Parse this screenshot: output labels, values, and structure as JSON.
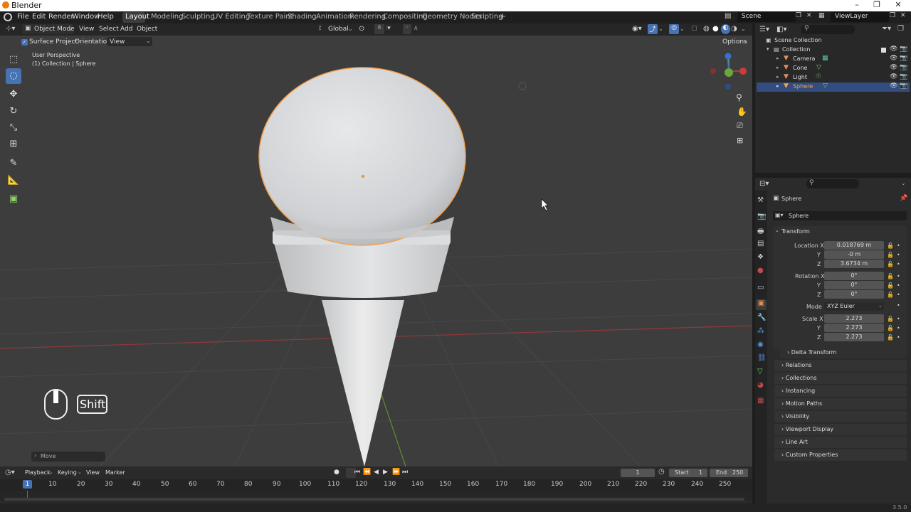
{
  "window": {
    "title": "Blender",
    "version": "3.5.0"
  },
  "menu": [
    "File",
    "Edit",
    "Render",
    "Window",
    "Help"
  ],
  "workspaces": [
    "Layout",
    "Modeling",
    "Sculpting",
    "UV Editing",
    "Texture Paint",
    "Shading",
    "Animation",
    "Rendering",
    "Compositing",
    "Geometry Nodes",
    "Scripting"
  ],
  "active_workspace": "Layout",
  "scene": {
    "name": "Scene",
    "viewlayer": "ViewLayer"
  },
  "viewport_header": {
    "mode": "Object Mode",
    "menus": [
      "View",
      "Select",
      "Add",
      "Object"
    ],
    "transform": "Global"
  },
  "tool_settings": {
    "surface_project": "Surface Project",
    "orientation_label": "Orientation:",
    "orientation_value": "View",
    "options": "Options"
  },
  "viewport": {
    "perspective": "User Perspective",
    "info": "(1) Collection | Sphere",
    "shift_label": "Shift",
    "last_op": "Move"
  },
  "outliner": {
    "root": "Scene Collection",
    "collection": "Collection",
    "items": [
      {
        "name": "Camera",
        "icon_color": "#e0905a"
      },
      {
        "name": "Cone",
        "icon_color": "#e0905a"
      },
      {
        "name": "Light",
        "icon_color": "#e0905a"
      },
      {
        "name": "Sphere",
        "icon_color": "#e0905a"
      }
    ],
    "selected": "Sphere"
  },
  "properties": {
    "object_name": "Sphere",
    "data_name": "Sphere",
    "transform_title": "Transform",
    "location_label": "Location X",
    "location": [
      "0.018769 m",
      "-0 m",
      "3.6734 m"
    ],
    "rotation_label": "Rotation X",
    "rotation": [
      "0°",
      "0°",
      "0°"
    ],
    "mode_label": "Mode",
    "mode": "XYZ Euler",
    "scale_label": "Scale X",
    "scale": [
      "2.273",
      "2.273",
      "2.273"
    ],
    "axis_y": "Y",
    "axis_z": "Z",
    "delta_transform": "Delta Transform",
    "sections": [
      "Relations",
      "Collections",
      "Instancing",
      "Motion Paths",
      "Visibility",
      "Viewport Display",
      "Line Art",
      "Custom Properties"
    ]
  },
  "timeline": {
    "menus": [
      "Playback",
      "Keying",
      "View",
      "Marker"
    ],
    "current_frame": "1",
    "start_label": "Start",
    "start": "1",
    "end_label": "End",
    "end": "250",
    "ticks": [
      "10",
      "20",
      "30",
      "40",
      "50",
      "60",
      "70",
      "80",
      "90",
      "100",
      "110",
      "120",
      "130",
      "140",
      "150",
      "160",
      "170",
      "180",
      "190",
      "200",
      "210",
      "220",
      "230",
      "240",
      "250"
    ]
  },
  "colors": {
    "accent": "#4772b3",
    "selection": "#f5a04a",
    "x_axis": "#d23a3a",
    "y_axis": "#6aa83b",
    "z_axis": "#3a6fd2"
  }
}
